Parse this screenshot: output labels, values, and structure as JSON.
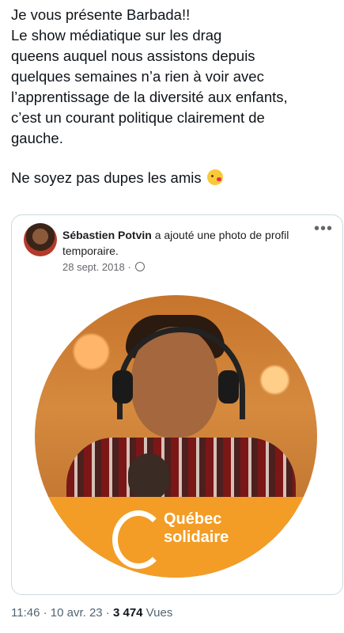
{
  "tweet": {
    "lines": [
      "Je vous présente Barbada!!",
      "Le show médiatique sur les drag",
      "queens auquel nous assistons depuis",
      "quelques semaines n’a rien à voir avec",
      "l’apprentissage de la diversité aux enfants,",
      "c’est un courant politique clairement de",
      "gauche."
    ],
    "closing": "Ne soyez pas dupes les amis",
    "emoji_name": "kiss-emoji"
  },
  "embedded_post": {
    "author": "Sébastien Potvin",
    "action": " a ajouté une photo de profil temporaire.",
    "date": "28 sept. 2018 ·",
    "more_icon": "more-dots-icon",
    "privacy_icon": "globe-icon",
    "photo": {
      "banner_line1": "Québec",
      "banner_line2": "solidaire",
      "banner_color": "#f39d26"
    }
  },
  "footer": {
    "time_date": "11:46 · 10 avr. 23 · ",
    "views_count": "3 474",
    "views_label": " Vues"
  }
}
